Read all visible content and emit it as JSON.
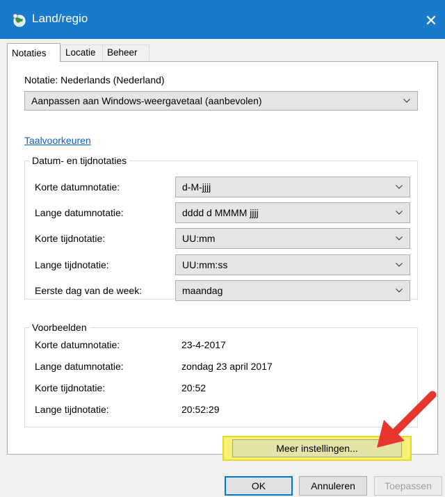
{
  "window": {
    "title": "Land/regio"
  },
  "tabs": [
    {
      "label": "Notaties"
    },
    {
      "label": "Locatie"
    },
    {
      "label": "Beheer"
    }
  ],
  "format": {
    "label": "Notatie: Nederlands (Nederland)",
    "selected": "Aanpassen aan Windows-weergavetaal (aanbevolen)"
  },
  "language_link": "Taalvoorkeuren",
  "datetime_group": {
    "title": "Datum- en tijdnotaties",
    "rows": [
      {
        "label": "Korte datumnotatie:",
        "value": "d-M-jjjj"
      },
      {
        "label": "Lange datumnotatie:",
        "value": "dddd d MMMM jjjj"
      },
      {
        "label": "Korte tijdnotatie:",
        "value": "UU:mm"
      },
      {
        "label": "Lange tijdnotatie:",
        "value": "UU:mm:ss"
      },
      {
        "label": "Eerste dag van de week:",
        "value": "maandag"
      }
    ]
  },
  "examples_group": {
    "title": "Voorbeelden",
    "rows": [
      {
        "label": "Korte datumnotatie:",
        "value": "23-4-2017"
      },
      {
        "label": "Lange datumnotatie:",
        "value": "zondag 23 april 2017"
      },
      {
        "label": "Korte tijdnotatie:",
        "value": "20:52"
      },
      {
        "label": "Lange tijdnotatie:",
        "value": "20:52:29"
      }
    ]
  },
  "buttons": {
    "more_settings": "Meer instellingen...",
    "ok": "OK",
    "cancel": "Annuleren",
    "apply": "Toepassen"
  },
  "colors": {
    "titlebar": "#1979ca",
    "link": "#0a60c2",
    "highlight": "#f3f275",
    "annotation_arrow": "#e8352e"
  },
  "icons": {
    "window": "globe-icon",
    "close": "close-icon",
    "dropdown": "chevron-down-icon"
  }
}
